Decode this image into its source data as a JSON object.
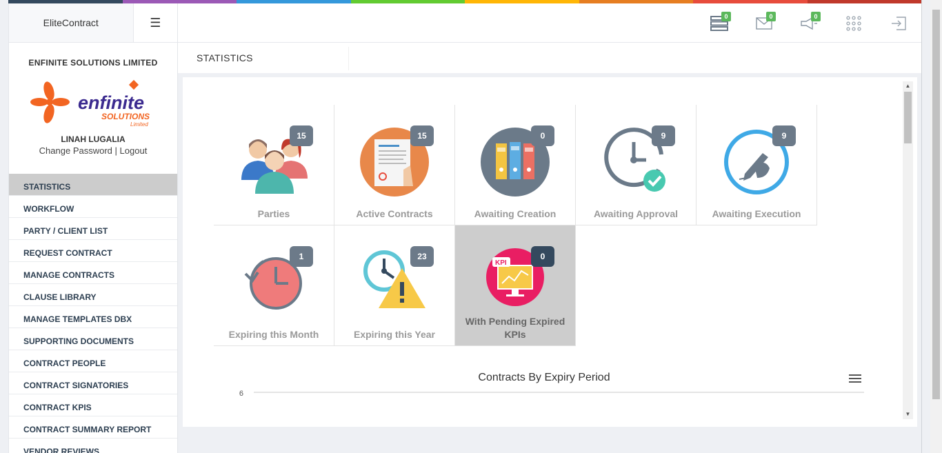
{
  "topbar_colors": [
    "#34495e",
    "#9b59b6",
    "#3498db",
    "#62cb31",
    "#ffb606",
    "#e67e22",
    "#e74c3c",
    "#c0392b"
  ],
  "brand": {
    "name": "EliteContract",
    "menu_icon": "☰"
  },
  "profile": {
    "company": "ENFINITE SOLUTIONS LIMITED",
    "logo": {
      "word": "enfinite",
      "sub": "SOLUTIONS",
      "tag": "Limited"
    },
    "user_name": "LINAH LUGALIA",
    "change_password": "Change Password",
    "separator": "|",
    "logout": "Logout"
  },
  "menu": [
    {
      "label": "STATISTICS",
      "active": true
    },
    {
      "label": "WORKFLOW"
    },
    {
      "label": "PARTY / CLIENT LIST"
    },
    {
      "label": "REQUEST CONTRACT"
    },
    {
      "label": "MANAGE CONTRACTS"
    },
    {
      "label": "CLAUSE LIBRARY"
    },
    {
      "label": "MANAGE TEMPLATES DBX"
    },
    {
      "label": "SUPPORTING DOCUMENTS"
    },
    {
      "label": "CONTRACT PEOPLE"
    },
    {
      "label": "CONTRACT SIGNATORIES"
    },
    {
      "label": "CONTRACT KPIS"
    },
    {
      "label": "CONTRACT SUMMARY REPORT"
    },
    {
      "label": "VENDOR REVIEWS"
    }
  ],
  "header_icons": [
    {
      "name": "server-icon",
      "count": "0"
    },
    {
      "name": "envelope-icon",
      "count": "0"
    },
    {
      "name": "megaphone-icon",
      "count": "0"
    },
    {
      "name": "apps-grid-icon",
      "count": ""
    },
    {
      "name": "logout-icon",
      "count": ""
    }
  ],
  "page_title": "STATISTICS",
  "tiles": [
    {
      "key": "parties",
      "label": "Parties",
      "count": "15",
      "icon": "people-icon"
    },
    {
      "key": "active",
      "label": "Active Contracts",
      "count": "15",
      "icon": "contract-document-icon"
    },
    {
      "key": "creation",
      "label": "Awaiting Creation",
      "count": "0",
      "icon": "binders-icon"
    },
    {
      "key": "approval",
      "label": "Awaiting Approval",
      "count": "9",
      "icon": "clock-check-icon"
    },
    {
      "key": "execution",
      "label": "Awaiting Execution",
      "count": "9",
      "icon": "signing-pen-icon"
    },
    {
      "key": "month",
      "label": "Expiring this Month",
      "count": "1",
      "icon": "clock-rewind-icon"
    },
    {
      "key": "year",
      "label": "Expiring this Year",
      "count": "23",
      "icon": "clock-warning-icon"
    },
    {
      "key": "kpis",
      "label": "With Pending Expired KPIs",
      "count": "0",
      "icon": "kpi-monitor-icon",
      "highlight": true
    }
  ],
  "chart_data": {
    "type": "bar",
    "title": "Contracts By Expiry Period",
    "y_ticks": [
      "6"
    ],
    "ylim": [
      0,
      6
    ]
  }
}
